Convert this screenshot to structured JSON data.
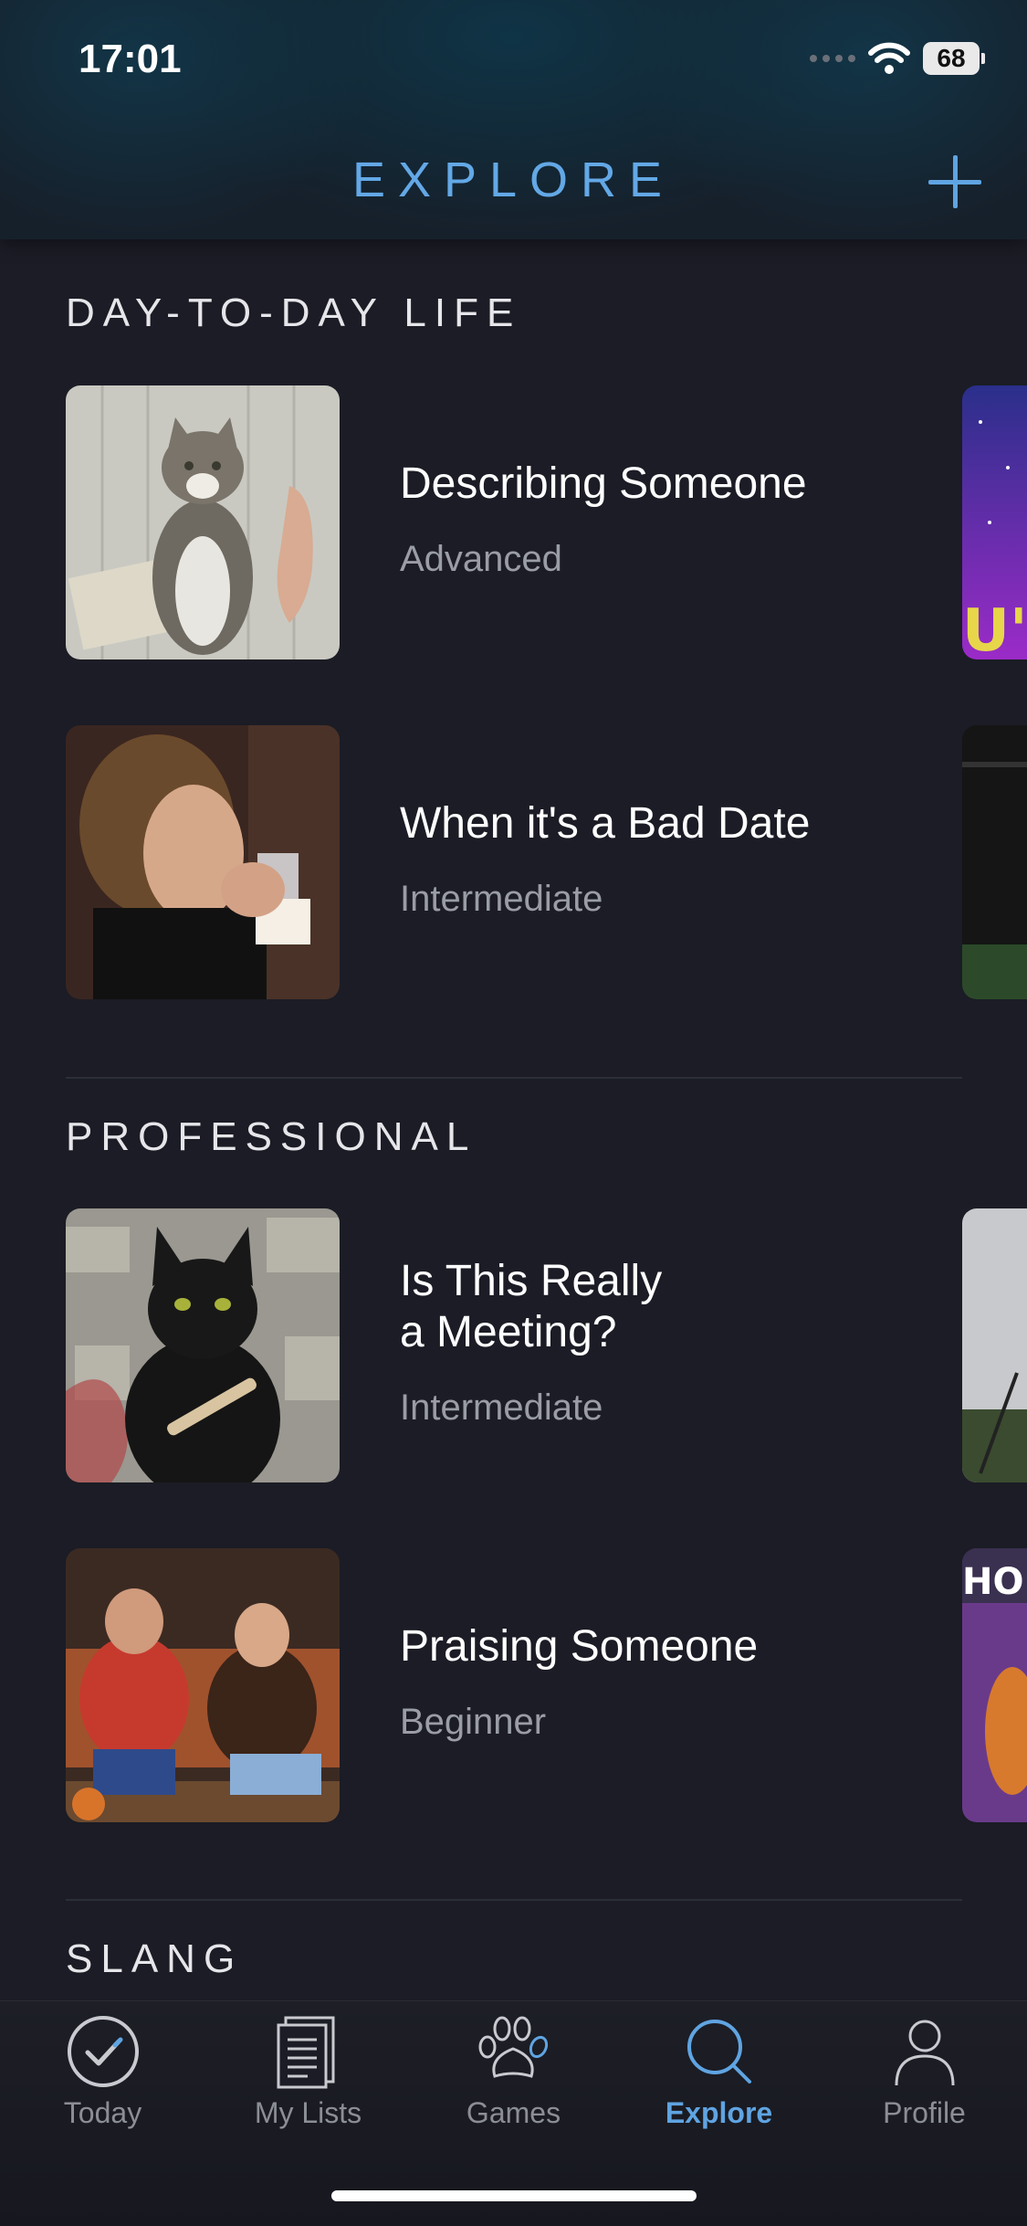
{
  "status_bar": {
    "time": "17:01",
    "battery": "68"
  },
  "header": {
    "title": "EXPLORE"
  },
  "sections": [
    {
      "title": "DAY-TO-DAY LIFE",
      "items": [
        {
          "title": "Describing Someone",
          "level": "Advanced"
        },
        {
          "title": "When it's a Bad Date",
          "level": "Intermediate"
        }
      ]
    },
    {
      "title": "PROFESSIONAL",
      "items": [
        {
          "title": "Is This Really\na Meeting?",
          "level": "Intermediate"
        },
        {
          "title": "Praising Someone",
          "level": "Beginner"
        }
      ]
    },
    {
      "title": "SLANG",
      "items": []
    }
  ],
  "peek_texts": [
    "U'R",
    "HO'S"
  ],
  "tabs": [
    {
      "label": "Today",
      "icon": "check-circle-icon",
      "active": false
    },
    {
      "label": "My Lists",
      "icon": "list-document-icon",
      "active": false
    },
    {
      "label": "Games",
      "icon": "paw-icon",
      "active": false
    },
    {
      "label": "Explore",
      "icon": "search-icon",
      "active": true
    },
    {
      "label": "Profile",
      "icon": "person-icon",
      "active": false
    }
  ],
  "colors": {
    "accent": "#5fa4e2",
    "background": "#1b1c25",
    "muted": "#9a9ca6"
  }
}
